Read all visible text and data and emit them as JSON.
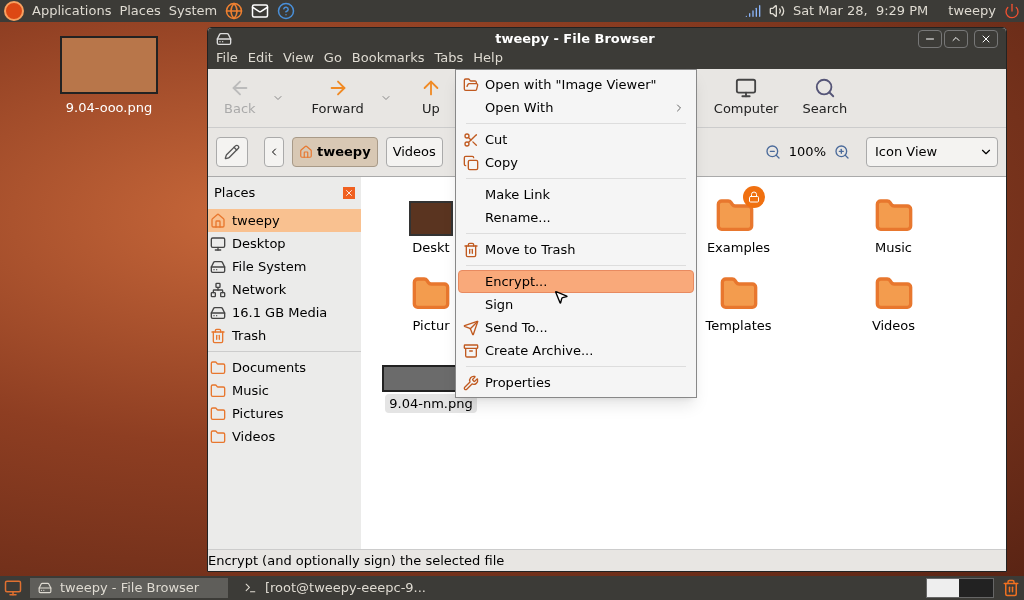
{
  "top_panel": {
    "menus": [
      "Applications",
      "Places",
      "System"
    ],
    "clock": "Sat Mar 28,  9:29 PM",
    "user": "tweepy"
  },
  "desktop_icons": [
    {
      "label": "9.04-ooo.png"
    }
  ],
  "window": {
    "title": "tweepy - File Browser",
    "menu": [
      "File",
      "Edit",
      "View",
      "Go",
      "Bookmarks",
      "Tabs",
      "Help"
    ],
    "toolbar": [
      {
        "kind": "back",
        "label": "Back",
        "disabled": true,
        "dropdown": true
      },
      {
        "kind": "forward",
        "label": "Forward",
        "disabled": false,
        "dropdown": true
      },
      {
        "kind": "up",
        "label": "Up",
        "disabled": false,
        "dropdown": false
      },
      {
        "kind": "computer",
        "label": "Computer",
        "disabled": false,
        "dropdown": false
      },
      {
        "kind": "search",
        "label": "Search",
        "disabled": false,
        "dropdown": false
      }
    ],
    "path": [
      {
        "label": "tweepy",
        "selected": true
      },
      {
        "label": "Videos",
        "selected": false
      }
    ],
    "zoom": "100%",
    "view": "Icon View",
    "sidebar": {
      "title": "Places",
      "places": [
        {
          "kind": "home",
          "label": "tweepy",
          "selected": true
        },
        {
          "kind": "desktop",
          "label": "Desktop",
          "selected": false
        },
        {
          "kind": "drive",
          "label": "File System",
          "selected": false
        },
        {
          "kind": "network",
          "label": "Network",
          "selected": false
        },
        {
          "kind": "drive",
          "label": "16.1 GB Media",
          "selected": false
        },
        {
          "kind": "trash",
          "label": "Trash",
          "selected": false
        }
      ],
      "bookmarks": [
        {
          "kind": "folder",
          "label": "Documents",
          "selected": false
        },
        {
          "kind": "folder",
          "label": "Music",
          "selected": false
        },
        {
          "kind": "folder",
          "label": "Pictures",
          "selected": false
        },
        {
          "kind": "folder",
          "label": "Videos",
          "selected": false
        }
      ]
    },
    "files": [
      {
        "items": [
          {
            "kind": "desktop",
            "label": "Deskt",
            "selected": false
          },
          {
            "kind": "locked-link",
            "label": "Examples",
            "selected": false
          },
          {
            "kind": "folder",
            "label": "Music",
            "selected": false
          }
        ]
      },
      {
        "items": [
          {
            "kind": "folder",
            "label": "Pictur",
            "selected": false
          },
          {
            "kind": "folder",
            "label": "Templates",
            "selected": false
          },
          {
            "kind": "folder",
            "label": "Videos",
            "selected": false
          }
        ]
      },
      {
        "items": [
          {
            "kind": "image",
            "label": "9.04-nm.png",
            "selected": true
          }
        ]
      }
    ],
    "status": "Encrypt (and optionally sign) the selected file"
  },
  "context_menu": [
    {
      "kind": "item",
      "label": "Open with \"Image Viewer\"",
      "submenu": false,
      "selected": false
    },
    {
      "kind": "item",
      "label": "Open With",
      "submenu": true,
      "selected": false
    },
    {
      "kind": "separator"
    },
    {
      "kind": "item",
      "label": "Cut",
      "submenu": false,
      "selected": false
    },
    {
      "kind": "item",
      "label": "Copy",
      "submenu": false,
      "selected": false
    },
    {
      "kind": "separator"
    },
    {
      "kind": "item",
      "label": "Make Link",
      "submenu": false,
      "selected": false
    },
    {
      "kind": "item",
      "label": "Rename...",
      "submenu": false,
      "selected": false
    },
    {
      "kind": "separator"
    },
    {
      "kind": "item",
      "label": "Move to Trash",
      "submenu": false,
      "selected": false
    },
    {
      "kind": "separator"
    },
    {
      "kind": "item",
      "label": "Encrypt...",
      "submenu": false,
      "selected": true
    },
    {
      "kind": "item",
      "label": "Sign",
      "submenu": false,
      "selected": false
    },
    {
      "kind": "item",
      "label": "Send To...",
      "submenu": false,
      "selected": false
    },
    {
      "kind": "item",
      "label": "Create Archive...",
      "submenu": false,
      "selected": false
    },
    {
      "kind": "separator"
    },
    {
      "kind": "item",
      "label": "Properties",
      "submenu": false,
      "selected": false
    }
  ],
  "taskbar": [
    {
      "kind": "folder",
      "label": "tweepy - File Browser",
      "selected": true
    },
    {
      "kind": "terminal",
      "label": "[root@tweepy-eeepc-9...",
      "selected": false
    }
  ]
}
